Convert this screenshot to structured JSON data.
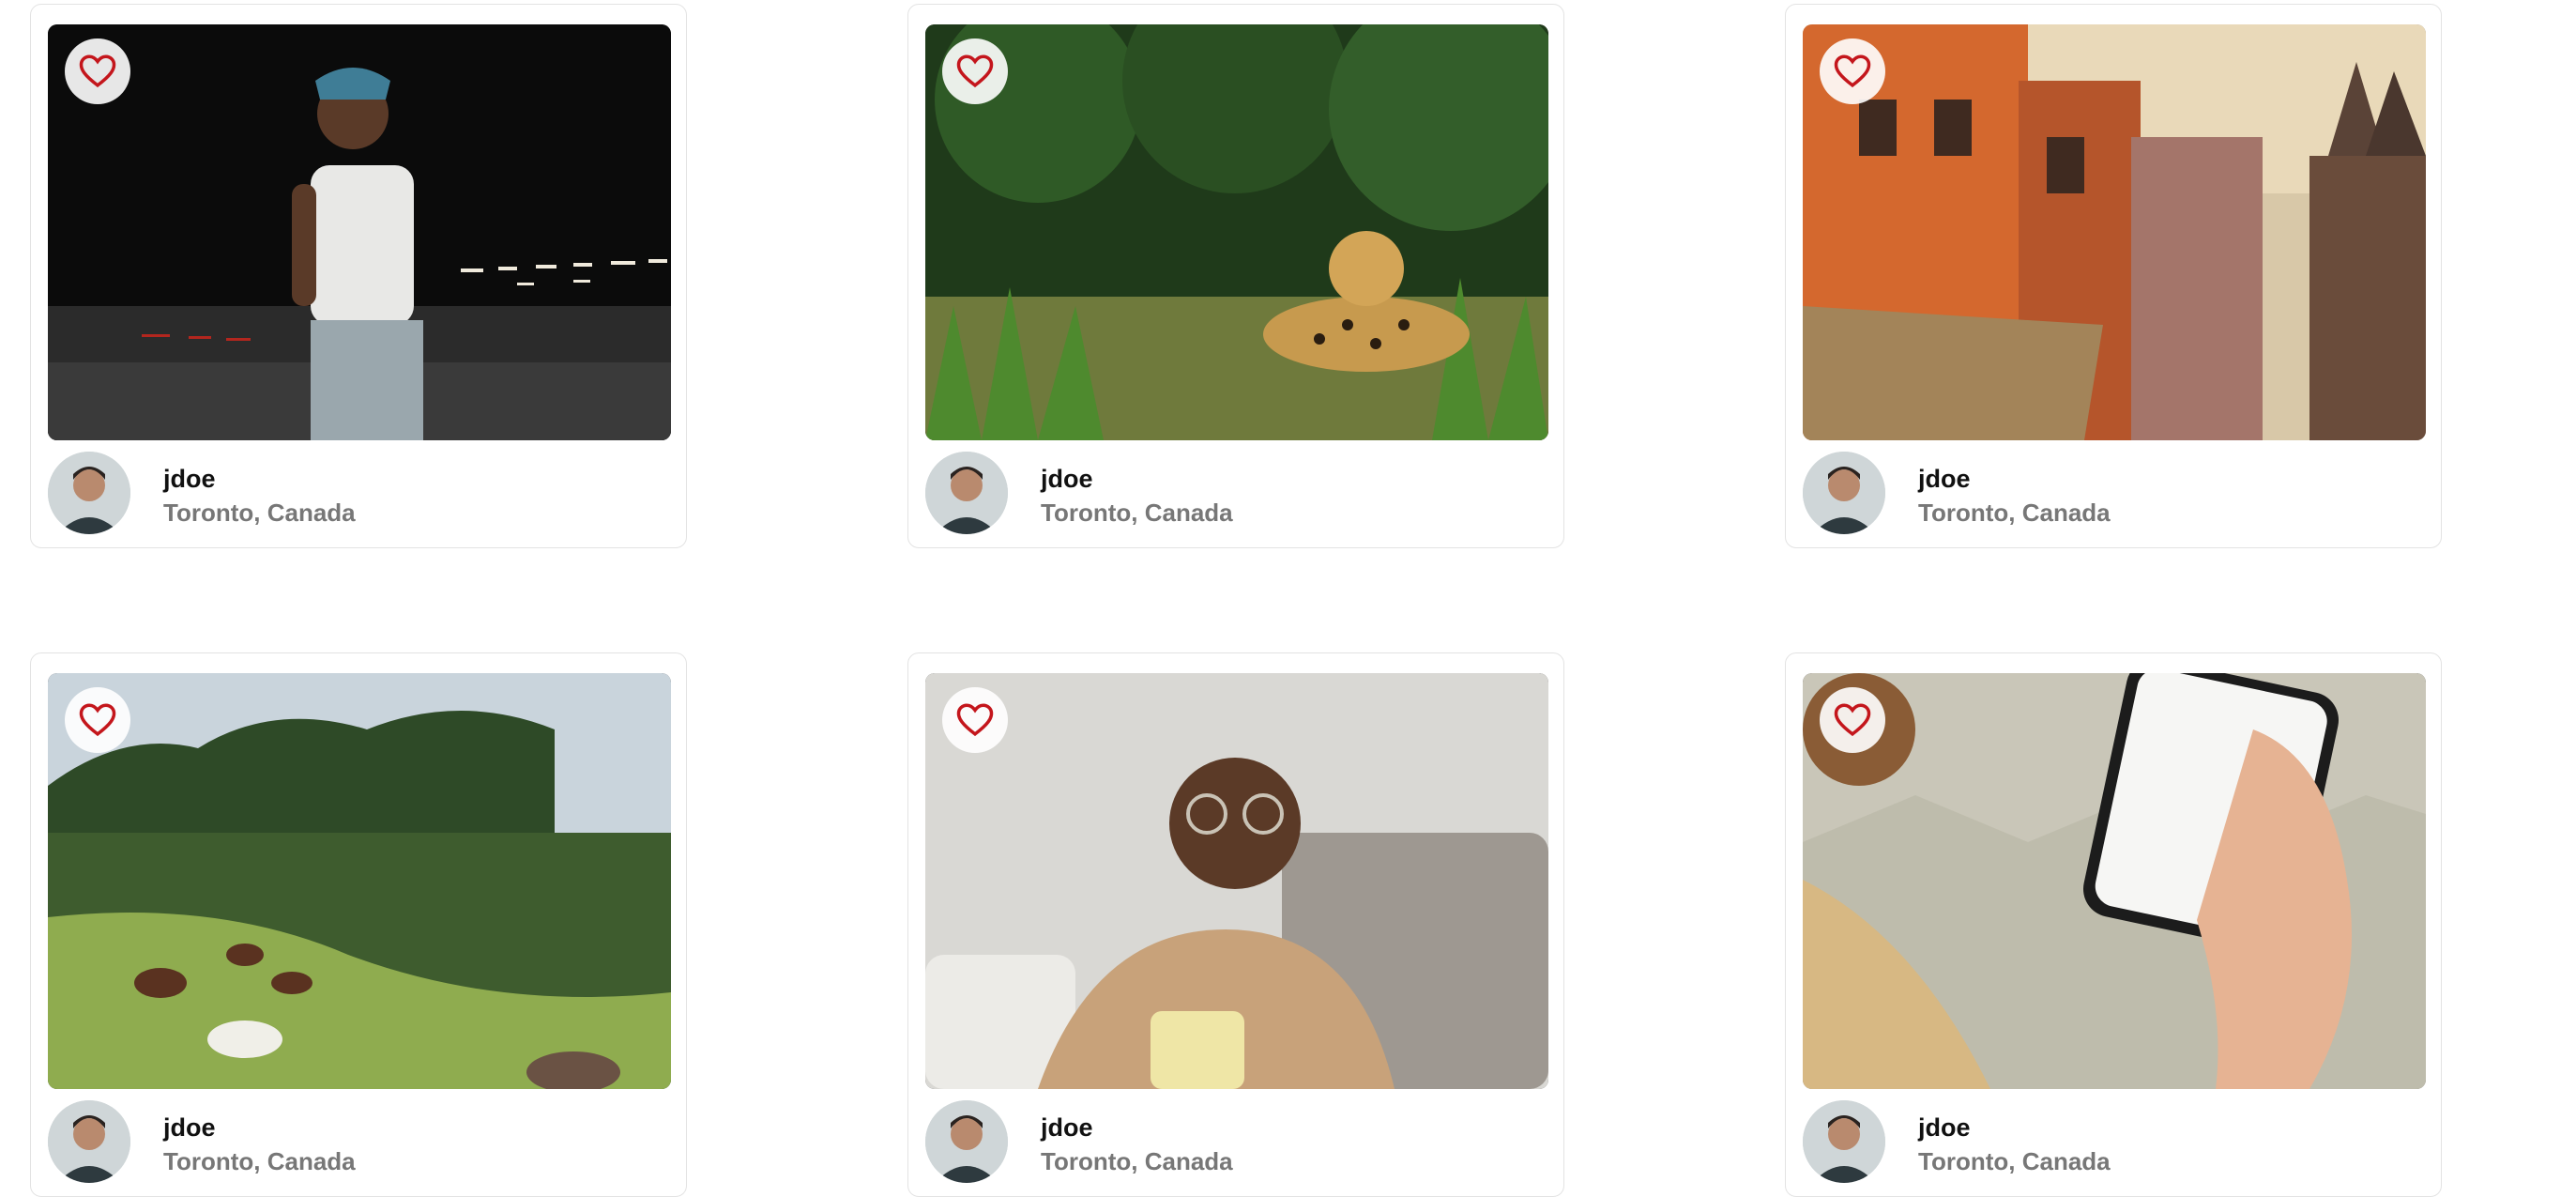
{
  "posts": [
    {
      "username": "jdoe",
      "location": "Toronto, Canada",
      "image": "man-walking-night-street"
    },
    {
      "username": "jdoe",
      "location": "Toronto, Canada",
      "image": "jaguar-in-grass"
    },
    {
      "username": "jdoe",
      "location": "Toronto, Canada",
      "image": "old-city-buildings"
    },
    {
      "username": "jdoe",
      "location": "Toronto, Canada",
      "image": "horses-grazing-hillside"
    },
    {
      "username": "jdoe",
      "location": "Toronto, Canada",
      "image": "smiling-man-with-cup"
    },
    {
      "username": "jdoe",
      "location": "Toronto, Canada",
      "image": "hand-holding-phone-app"
    }
  ],
  "icons": {
    "like": "heart-outline-icon"
  },
  "colors": {
    "heart": "#c4161c",
    "location_text": "#777777",
    "card_border": "#e3e3e3"
  }
}
